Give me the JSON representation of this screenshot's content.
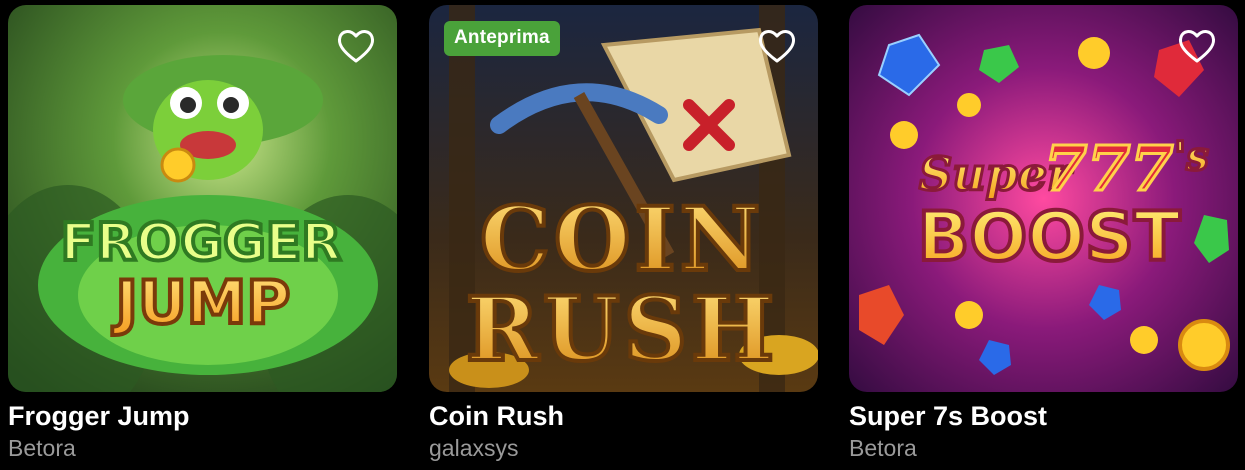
{
  "games": [
    {
      "title": "Frogger Jump",
      "provider": "Betora",
      "art_text": [
        "FROGGER",
        "JUMP"
      ],
      "badge": "",
      "accent": "#39a43a"
    },
    {
      "title": "Coin Rush",
      "provider": "galaxsys",
      "art_text": [
        "COIN",
        "RUSH"
      ],
      "badge": "Anteprima",
      "accent": "#e8b230"
    },
    {
      "title": "Super 7s Boost",
      "provider": "Betora",
      "art_text": [
        "Super",
        "777",
        "'s",
        "BOOST"
      ],
      "badge": "",
      "accent": "#e03a6a"
    }
  ],
  "icons": {
    "favorite": "heart-outline-icon"
  }
}
